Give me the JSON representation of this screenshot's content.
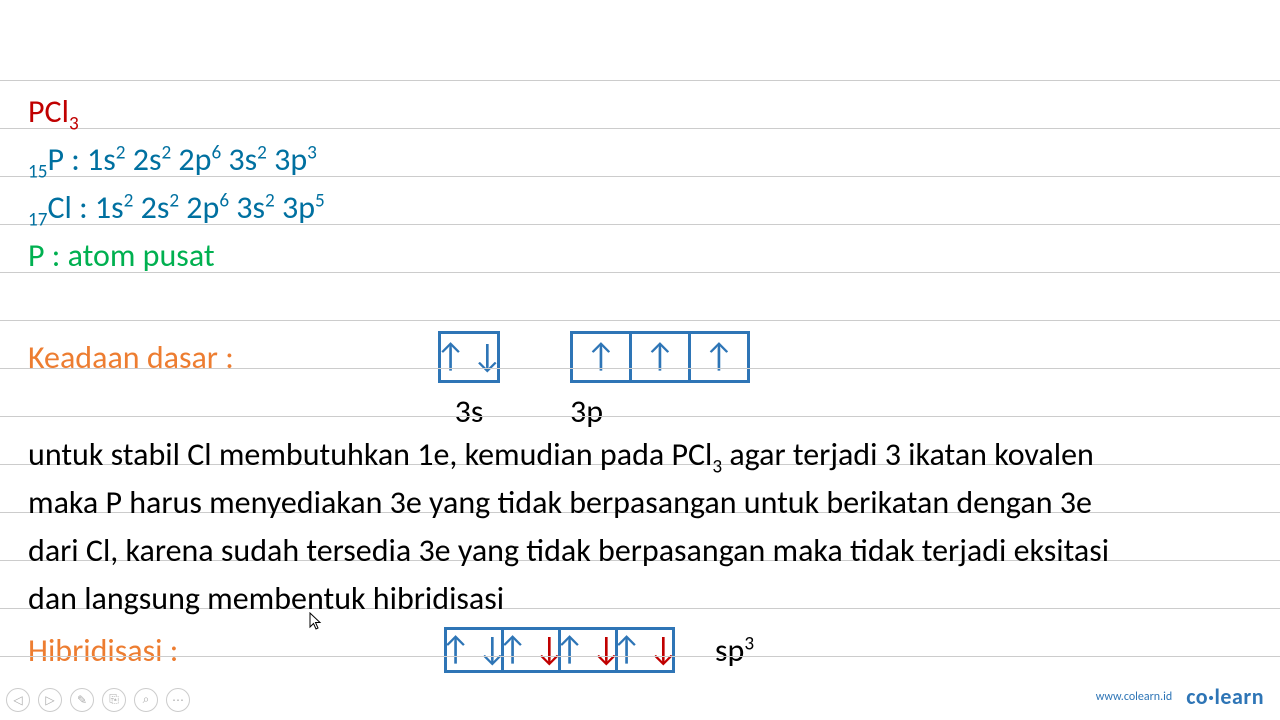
{
  "title": {
    "formula_base": "PCl",
    "formula_sub": "3"
  },
  "p_line": {
    "sub": "15",
    "sym": "P",
    "sep": " : ",
    "c": [
      "1s",
      "2s",
      "2p",
      "3s",
      "3p"
    ],
    "e": [
      "2",
      "2",
      "6",
      "2",
      "3"
    ]
  },
  "cl_line": {
    "sub": "17",
    "sym": "Cl",
    "sep": " : ",
    "c": [
      "1s",
      "2s",
      "2p",
      "3s",
      "3p"
    ],
    "e": [
      "2",
      "2",
      "6",
      "2",
      "5"
    ]
  },
  "atom_pusat": "P : atom pusat",
  "keadaan_label": "Keadaan dasar :",
  "orbital_3s_label": "3s",
  "orbital_3p_label": "3p",
  "paragraph": {
    "l1a": "untuk stabil Cl membutuhkan 1e, kemudian pada PCl",
    "l1b": " agar terjadi 3 ikatan kovalen",
    "l1sub": "3",
    "l2": "maka P harus menyediakan 3e yang tidak berpasangan untuk berikatan dengan 3e",
    "l3": "dari Cl, karena sudah tersedia 3e yang tidak berpasangan maka tidak terjadi eksitasi",
    "l4": "dan langsung membentuk hibridisasi"
  },
  "hibrid_label": "Hibridisasi :",
  "sp3_base": "sp",
  "sp3_sup": "3",
  "footer": {
    "url": "www.colearn.id",
    "logo_a": "co",
    "logo_dot": "·",
    "logo_b": "learn",
    "icons": [
      "◁",
      "▷",
      "✎",
      "⎘",
      "⌕",
      "⋯"
    ]
  },
  "arrows": {
    "up": "↑",
    "down": "↓"
  }
}
